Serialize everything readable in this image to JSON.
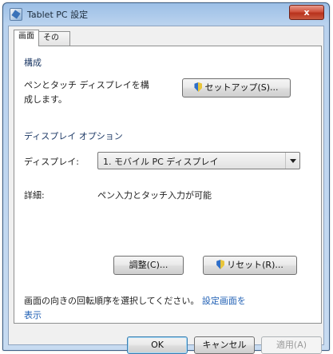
{
  "window": {
    "title": "Tablet PC 設定",
    "close_label": "x"
  },
  "tabs": [
    {
      "label": "画面"
    },
    {
      "label": "その他"
    }
  ],
  "configure": {
    "group_label": "構成",
    "description_line1": "ペンとタッチ ディスプレイを構",
    "description_line2": "成します。",
    "setup_button": "セットアップ(S)..."
  },
  "display_options": {
    "group_label": "ディスプレイ オプション",
    "display_label": "ディスプレイ:",
    "display_value": "1. モバイル PC ディスプレイ",
    "details_label": "詳細:",
    "details_value": "ペン入力とタッチ入力が可能",
    "calibrate_button": "調整(C)...",
    "reset_button": "リセット(R)..."
  },
  "orientation": {
    "text": "画面の向きの回転順序を選択してください。",
    "link_line1": "設定画面を",
    "link_line2": "表示"
  },
  "footer": {
    "ok": "OK",
    "cancel": "キャンセル",
    "apply": "適用(A)"
  }
}
